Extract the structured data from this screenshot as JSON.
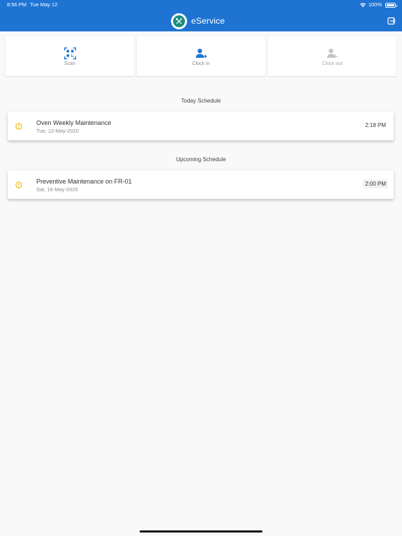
{
  "status_bar": {
    "time": "8:56 PM",
    "date": "Tue May 12",
    "battery": "100%"
  },
  "header": {
    "title": "eService",
    "logo_icon": "wrench-screwdriver-icon",
    "logout_icon": "logout-icon"
  },
  "actions": [
    {
      "label": "Scan",
      "icon": "qr-code-icon",
      "enabled": true
    },
    {
      "label": "Clock in",
      "icon": "clock-in-user-icon",
      "enabled": true
    },
    {
      "label": "Clock out",
      "icon": "clock-out-user-icon",
      "enabled": false
    }
  ],
  "today": {
    "heading": "Today Schedule",
    "items": [
      {
        "title": "Oven Weekly Maintenance",
        "date": "Tue, 12-May-2020",
        "time": "2:18 PM"
      }
    ]
  },
  "upcoming": {
    "heading": "Upcoming Schedule",
    "items": [
      {
        "title": "Preventive Maintenance on FR-01",
        "date": "Sat, 16-May-2020",
        "time": "2:00 PM"
      }
    ]
  },
  "colors": {
    "primary": "#1f74d3",
    "warning": "#f0b400",
    "logo_bg": "#1a8c7e",
    "disabled": "#c4c4c4"
  }
}
